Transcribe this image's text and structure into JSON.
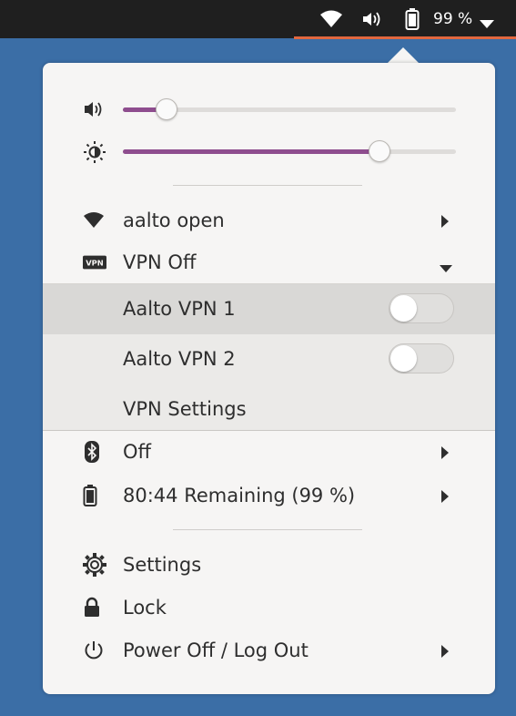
{
  "topbar": {
    "wifi_icon": "wifi-icon",
    "volume_icon": "speaker-icon",
    "battery_icon": "battery-icon",
    "battery_percent": "99 %",
    "menu_arrow_icon": "triangle-down-icon",
    "accent_color": "#e1673f"
  },
  "menu": {
    "volume": {
      "icon": "speaker-icon",
      "level": 0.13
    },
    "brightness": {
      "icon": "brightness-icon",
      "level": 0.77
    },
    "slider_fill_color": "#8e4d8e",
    "items": [
      {
        "icon": "wifi-icon",
        "label": "aalto open",
        "arrow": "triangle-right-icon"
      },
      {
        "icon": "vpn-icon",
        "label": "VPN Off",
        "arrow": "triangle-down-icon"
      }
    ],
    "vpn_submenu": [
      {
        "label": "Aalto VPN 1",
        "enabled": false
      },
      {
        "label": "Aalto VPN 2",
        "enabled": false
      },
      {
        "label": "VPN Settings"
      }
    ],
    "status_items": [
      {
        "icon": "bluetooth-icon",
        "label": "Off",
        "arrow": "triangle-right-icon"
      },
      {
        "icon": "battery-icon",
        "label": "80:44 Remaining (99 %)",
        "arrow": "triangle-right-icon"
      }
    ],
    "system_items": [
      {
        "icon": "gear-icon",
        "label": "Settings"
      },
      {
        "icon": "lock-icon",
        "label": "Lock"
      },
      {
        "icon": "power-icon",
        "label": "Power Off / Log Out",
        "arrow": "triangle-right-icon"
      }
    ]
  }
}
